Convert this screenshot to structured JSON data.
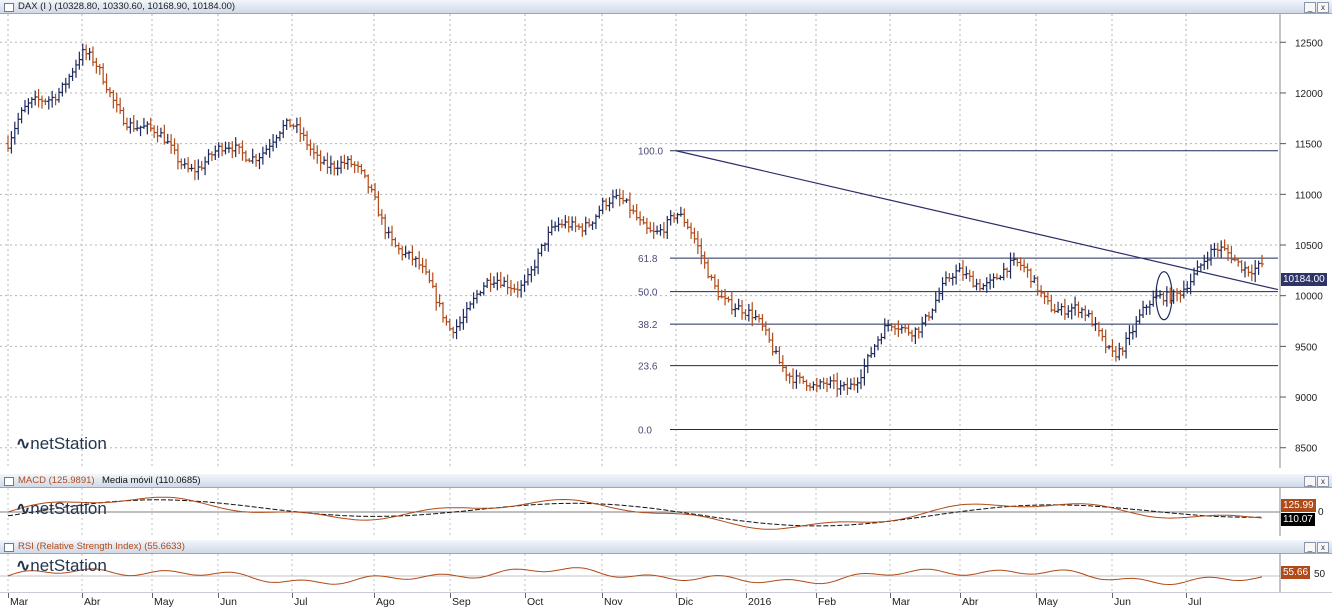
{
  "price_panel": {
    "title": "DAX (I ) (10328.80, 10330.60, 10168.90, 10184.00)",
    "last_price_label": "10184.00",
    "logo": "netStation"
  },
  "macd_panel": {
    "title_macd": "MACD (125.9891)",
    "title_signal": "Media móvil (110.0685)",
    "macd_value_label": "125.99",
    "signal_value_label": "110.07",
    "zero_label": "0",
    "logo": "netStation"
  },
  "rsi_panel": {
    "title": "RSI (Relative Strength Index) (55.6633)",
    "value_label": "55.66",
    "mid_label": "50",
    "logo": "netStation"
  },
  "window_buttons": {
    "minimize": "_",
    "close": "x"
  },
  "x_axis_labels": [
    "Mar",
    "Abr",
    "May",
    "Jun",
    "Jul",
    "Ago",
    "Sep",
    "Oct",
    "Nov",
    "Dic",
    "2016",
    "Feb",
    "Mar",
    "Abr",
    "May",
    "Jun",
    "Jul"
  ],
  "colors": {
    "up": "#1e2a5c",
    "down": "#b04a18",
    "trendline": "#2a2e6a",
    "fib": "#1e2a5c",
    "macd": "#b04a18",
    "signal": "#111111",
    "rsi": "#b04a18"
  },
  "chart_data": [
    {
      "type": "line",
      "title": "DAX (I )",
      "series": [
        {
          "name": "",
          "x": [
            "Mar",
            "Abr",
            "May",
            "Jun",
            "Jul",
            "Ago",
            "Sep",
            "Oct",
            "Nov",
            "Dic",
            "2016",
            "Feb",
            "Mar",
            "Abr",
            "May",
            "Jun",
            "Jul"
          ],
          "values": [
            11500,
            12150,
            11650,
            11450,
            11400,
            11050,
            9900,
            10050,
            10950,
            10900,
            9600,
            8900,
            9800,
            10100,
            10000,
            9700,
            10200
          ]
        }
      ],
      "last_close": 10184.0,
      "last_ohlc": {
        "open": 10328.8,
        "high": 10330.6,
        "low": 10168.9,
        "close": 10184.0
      },
      "y_ticks": [
        8500,
        9000,
        9500,
        10000,
        10500,
        11000,
        11500,
        12000,
        12500
      ],
      "ylim": [
        8300,
        12700
      ],
      "annotations": {
        "fibonacci_levels": [
          {
            "label": "100.0",
            "value": 11430
          },
          {
            "label": "61.8",
            "value": 10370
          },
          {
            "label": "50.0",
            "value": 10040
          },
          {
            "label": "38.2",
            "value": 9720
          },
          {
            "label": "23.6",
            "value": 9310
          },
          {
            "label": "0.0",
            "value": 8680
          }
        ],
        "trendline": {
          "from": {
            "x": "Dic",
            "value": 11430
          },
          "to": {
            "x": "Jul",
            "value": 10060
          }
        },
        "ellipse_marker": {
          "x": "Jun",
          "value": 10000
        }
      }
    },
    {
      "type": "line",
      "title": "MACD",
      "series": [
        {
          "name": "MACD",
          "last": 125.9891
        },
        {
          "name": "Media móvil",
          "last": 110.0685
        }
      ],
      "y_ticks": [
        0
      ]
    },
    {
      "type": "line",
      "title": "RSI (Relative Strength Index)",
      "series": [
        {
          "name": "RSI",
          "last": 55.6633
        }
      ],
      "y_ticks": [
        50
      ]
    }
  ]
}
